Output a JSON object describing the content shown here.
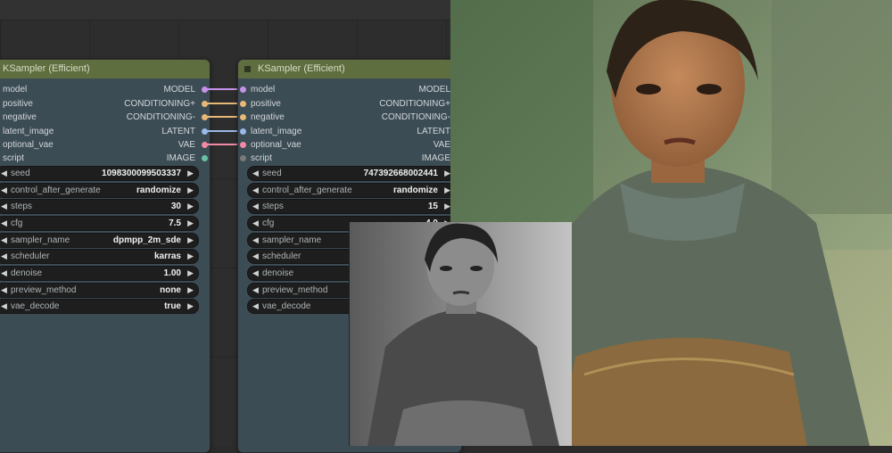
{
  "nodes": [
    {
      "title": "KSampler (Efficient)",
      "inputs": [
        "model",
        "positive",
        "negative",
        "latent_image",
        "optional_vae",
        "script"
      ],
      "outputs": [
        "MODEL",
        "CONDITIONING+",
        "CONDITIONING-",
        "LATENT",
        "VAE",
        "IMAGE"
      ],
      "widgets": [
        {
          "label": "seed",
          "value": "1098300099503337"
        },
        {
          "label": "control_after_generate",
          "value": "randomize"
        },
        {
          "label": "steps",
          "value": "30"
        },
        {
          "label": "cfg",
          "value": "7.5"
        },
        {
          "label": "sampler_name",
          "value": "dpmpp_2m_sde"
        },
        {
          "label": "scheduler",
          "value": "karras"
        },
        {
          "label": "denoise",
          "value": "1.00"
        },
        {
          "label": "preview_method",
          "value": "none"
        },
        {
          "label": "vae_decode",
          "value": "true"
        }
      ]
    },
    {
      "title": "KSampler (Efficient)",
      "inputs": [
        "model",
        "positive",
        "negative",
        "latent_image",
        "optional_vae",
        "script"
      ],
      "outputs": [
        "MODEL",
        "CONDITIONING+",
        "CONDITIONING-",
        "LATENT",
        "VAE",
        "IMAGE"
      ],
      "widgets": [
        {
          "label": "seed",
          "value": "747392668002441"
        },
        {
          "label": "control_after_generate",
          "value": "randomize"
        },
        {
          "label": "steps",
          "value": "15"
        },
        {
          "label": "cfg",
          "value": "4.0"
        },
        {
          "label": "sampler_name",
          "value": ""
        },
        {
          "label": "scheduler",
          "value": ""
        },
        {
          "label": "denoise",
          "value": ""
        },
        {
          "label": "preview_method",
          "value": ""
        },
        {
          "label": "vae_decode",
          "value": ""
        }
      ]
    }
  ],
  "colors": {
    "model": "#c792ea",
    "conditioning_pos": "#e8b878",
    "conditioning_neg": "#e8b878",
    "latent": "#9bb8e8",
    "vae": "#f08aa6",
    "image": "#6ac0a4",
    "script": "#7a7a7a",
    "node_title": "#5f6e3f",
    "node_body": "#3c4c55"
  },
  "icons": [
    "arrow-left-icon",
    "arrow-right-icon",
    "collapse-icon"
  ],
  "images": [
    "colorized-portrait",
    "original-bw-portrait"
  ]
}
